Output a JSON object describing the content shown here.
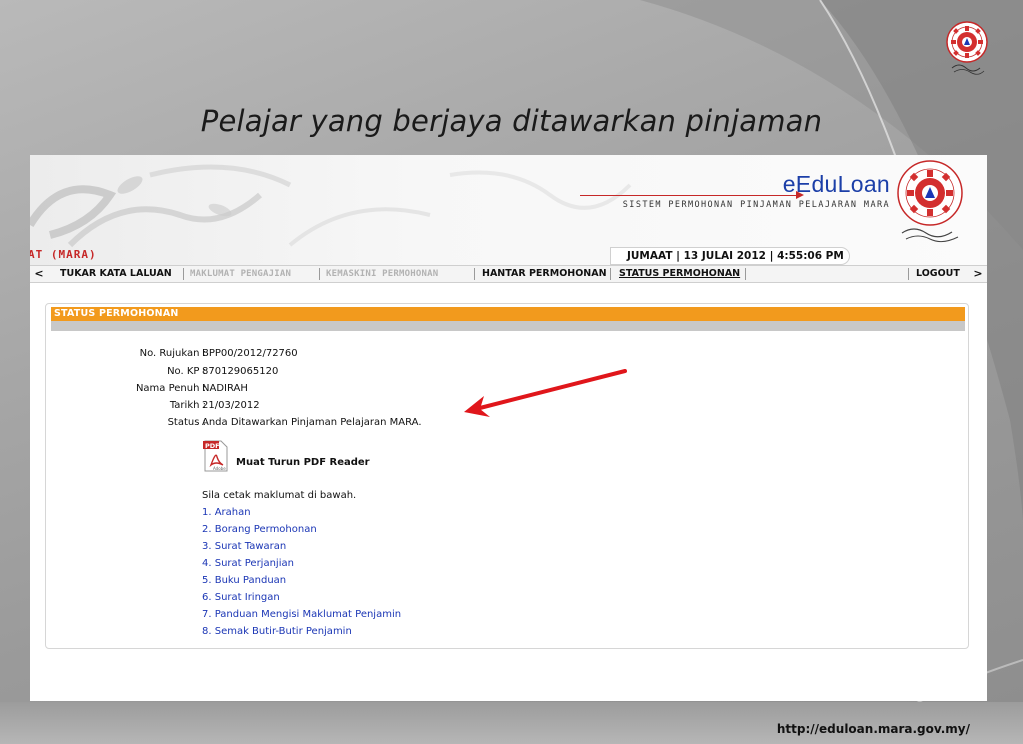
{
  "slide": {
    "title": "Pelajar yang berjaya ditawarkan pinjaman",
    "footer_url": "http://eduloan.mara.gov.my/"
  },
  "banner": {
    "brand_name": "eEduLoan",
    "brand_subtitle": "SISTEM PERMOHONAN PINJAMAN PELAJARAN MARA",
    "org_text": "AT (MARA)",
    "datetime": "JUMAAT | 13 JULAI 2012 | 4:55:06 PM"
  },
  "nav": {
    "items": [
      {
        "label": "TUKAR KATA LALUAN",
        "state": "active"
      },
      {
        "label": "MAKLUMAT PENGAJIAN",
        "state": "disabled"
      },
      {
        "label": "KEMASKINI PERMOHONAN",
        "state": "disabled"
      },
      {
        "label": "HANTAR PERMOHONAN",
        "state": "active"
      },
      {
        "label": "STATUS PERMOHONAN",
        "state": "current"
      }
    ],
    "logout": "LOGOUT",
    "prev_arrow": "<",
    "next_arrow": ">"
  },
  "panel": {
    "title": "STATUS PERMOHONAN",
    "fields": [
      {
        "label": "No. Rujukan :",
        "value": "BPP00/2012/72760"
      },
      {
        "label": "No. KP :",
        "value": "870129065120"
      },
      {
        "label": "Nama Penuh :",
        "value": "NADIRAH"
      },
      {
        "label": "Tarikh :",
        "value": "21/03/2012"
      },
      {
        "label": "Status :",
        "value": "Anda Ditawarkan Pinjaman Pelajaran MARA."
      }
    ],
    "pdf_icon_text": "PDF",
    "pdf_icon_sub": "Adobe",
    "pdf_link": "Muat Turun PDF Reader",
    "print_note": "Sila cetak maklumat di bawah.",
    "documents": [
      "1. Arahan",
      "2. Borang Permohonan",
      "3. Surat Tawaran",
      "4. Surat Perjanjian",
      "5. Buku Panduan",
      "6. Surat Iringan",
      "7. Panduan Mengisi Maklumat Penjamin",
      "8. Semak Butir-Butir Penjamin"
    ]
  },
  "colors": {
    "accent_orange": "#f29a1d",
    "brand_blue": "#1c3fa8",
    "link_blue": "#1b36b5",
    "annotation_red": "#e0161b",
    "org_red": "#c62828"
  }
}
